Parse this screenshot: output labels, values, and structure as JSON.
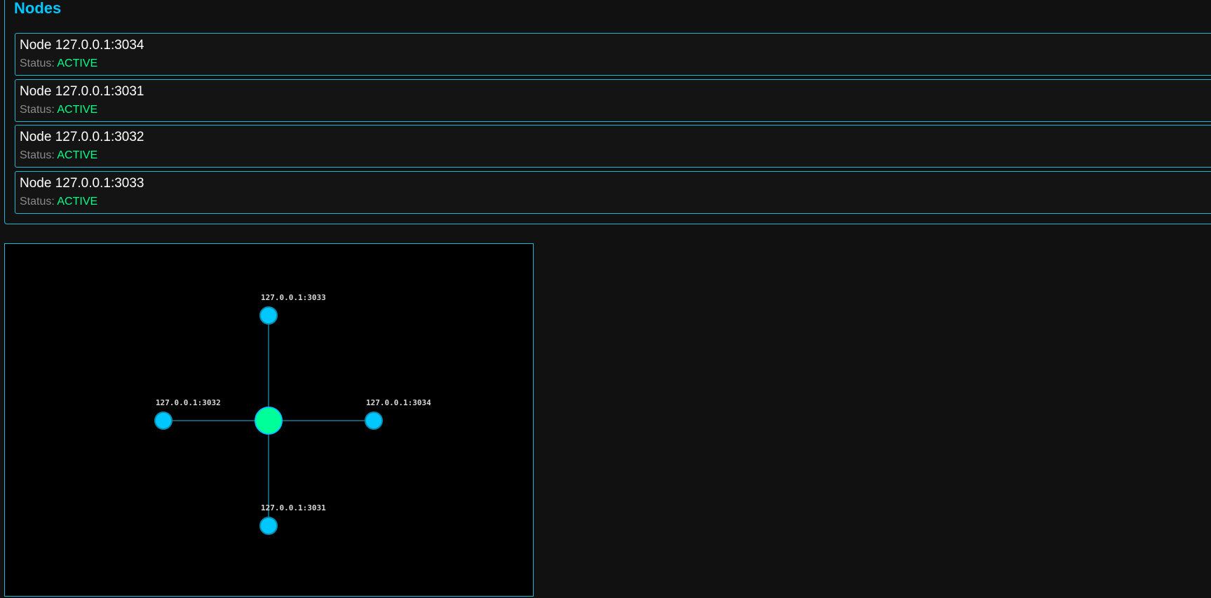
{
  "panel": {
    "title": "Nodes"
  },
  "nodes": [
    {
      "name": "Node 127.0.0.1:3034",
      "status_label": "Status:",
      "status": "ACTIVE"
    },
    {
      "name": "Node 127.0.0.1:3031",
      "status_label": "Status:",
      "status": "ACTIVE"
    },
    {
      "name": "Node 127.0.0.1:3032",
      "status_label": "Status:",
      "status": "ACTIVE"
    },
    {
      "name": "Node 127.0.0.1:3033",
      "status_label": "Status:",
      "status": "ACTIVE"
    }
  ],
  "graph": {
    "center_node": "self",
    "peers": [
      {
        "label": "127.0.0.1:3033",
        "direction": "up"
      },
      {
        "label": "127.0.0.1:3032",
        "direction": "left"
      },
      {
        "label": "127.0.0.1:3034",
        "direction": "right"
      },
      {
        "label": "127.0.0.1:3031",
        "direction": "down"
      }
    ]
  },
  "colors": {
    "accent": "#00c8ff",
    "active": "#00ff88",
    "border": "#1fb6d6",
    "background": "#111111"
  }
}
